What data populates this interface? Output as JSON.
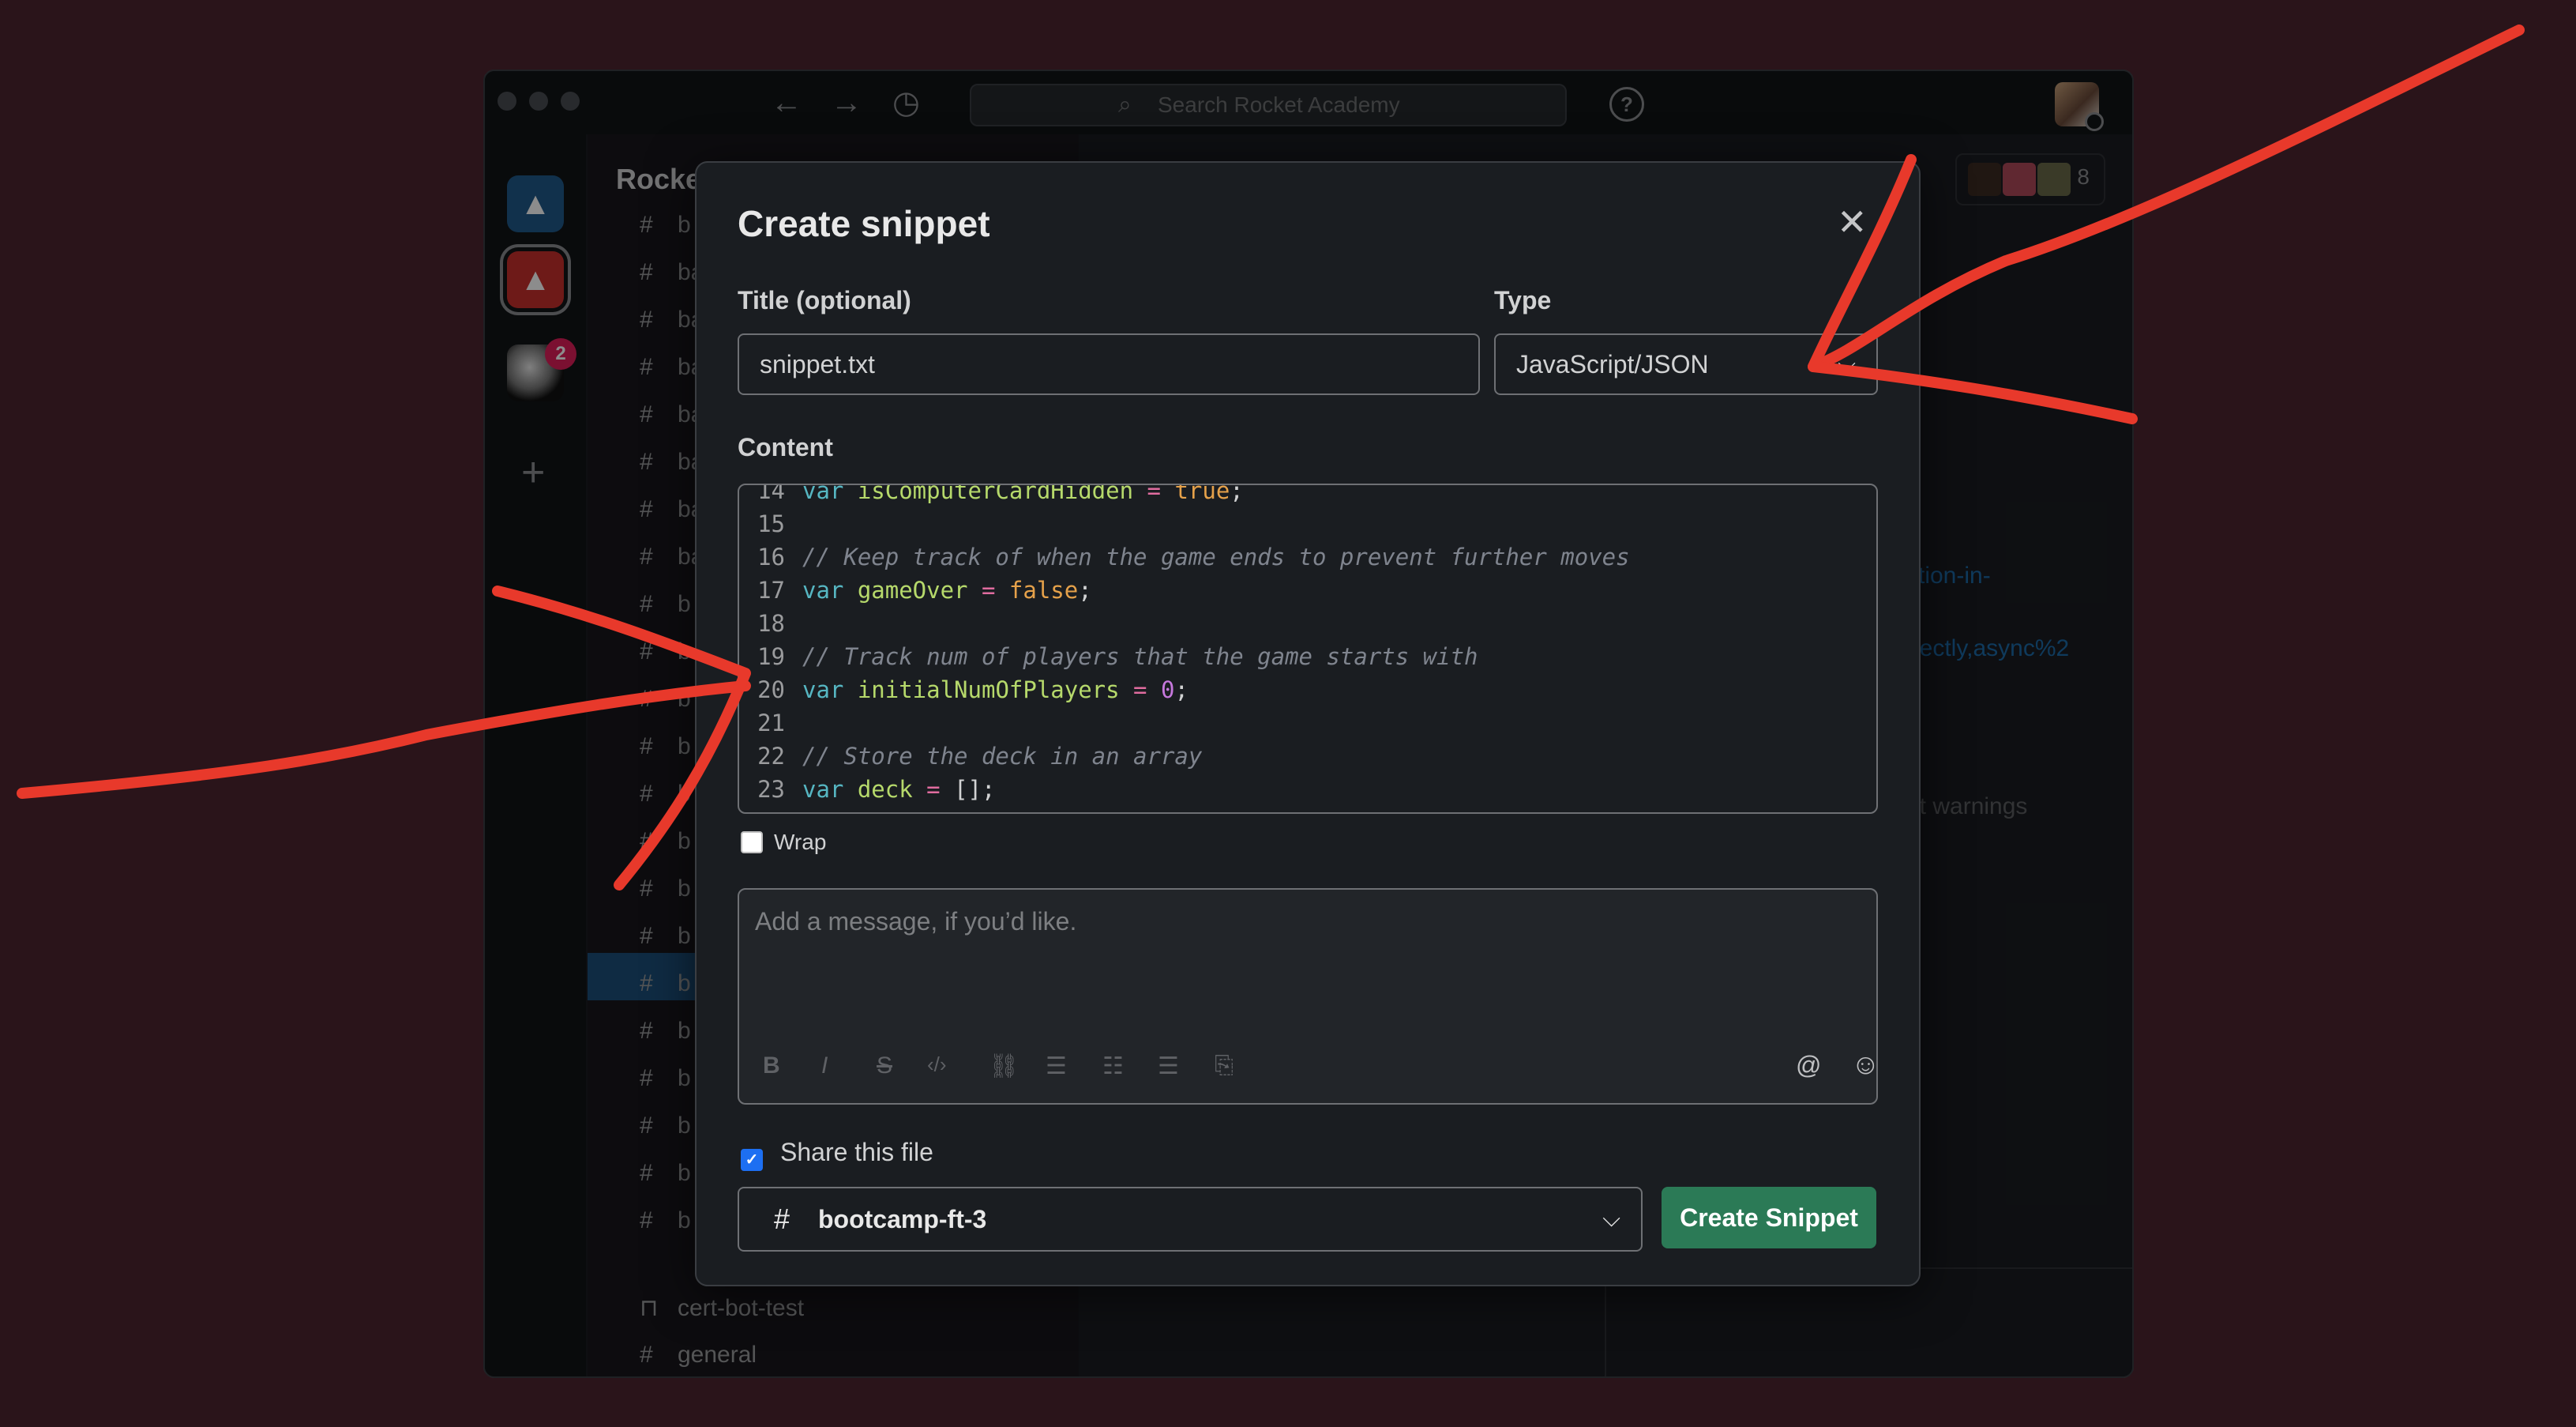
{
  "app": {
    "search_placeholder": "Search Rocket Academy",
    "workspace_name": "Rocke",
    "workspace_badge": "2",
    "member_count": "8",
    "sidebar_channels": [
      "b",
      "ba",
      "ba",
      "ba",
      "ba",
      "ba",
      "ba",
      "ba",
      "b",
      "b",
      "b",
      "b",
      "b",
      "b",
      "b",
      "b",
      "b",
      "b",
      "b",
      "b",
      "b",
      "b"
    ],
    "sidebar_cert": "cert-bot-test",
    "sidebar_general": "general",
    "main_snippets": [
      "ction-in-",
      "irectly,async%2",
      "et warnings"
    ]
  },
  "modal": {
    "title": "Create snippet",
    "title_label": "Title (optional)",
    "title_value": "snippet.txt",
    "type_label": "Type",
    "type_value": "JavaScript/JSON",
    "content_label": "Content",
    "wrap_label": "Wrap",
    "wrap_checked": false,
    "message_placeholder": "Add a message, if you’d like.",
    "share_label": "Share this file",
    "share_checked": true,
    "channel_hash": "#",
    "channel_name": "bootcamp-ft-3",
    "create_button": "Create Snippet"
  },
  "code_lines": [
    {
      "n": "14",
      "tokens": [
        {
          "t": "var ",
          "c": "kw"
        },
        {
          "t": "isComputerCardHidden",
          "c": "id"
        },
        {
          "t": " = ",
          "c": "op"
        },
        {
          "t": "true",
          "c": "lit"
        },
        {
          "t": ";",
          "c": "pn"
        }
      ]
    },
    {
      "n": "15",
      "tokens": []
    },
    {
      "n": "16",
      "tokens": [
        {
          "t": "// Keep track of when the game ends to prevent further moves",
          "c": "cm"
        }
      ]
    },
    {
      "n": "17",
      "tokens": [
        {
          "t": "var ",
          "c": "kw"
        },
        {
          "t": "gameOver",
          "c": "id"
        },
        {
          "t": " = ",
          "c": "op"
        },
        {
          "t": "false",
          "c": "lit"
        },
        {
          "t": ";",
          "c": "pn"
        }
      ]
    },
    {
      "n": "18",
      "tokens": []
    },
    {
      "n": "19",
      "tokens": [
        {
          "t": "// Track num of players that the game starts with",
          "c": "cm"
        }
      ]
    },
    {
      "n": "20",
      "tokens": [
        {
          "t": "var ",
          "c": "kw"
        },
        {
          "t": "initialNumOfPlayers",
          "c": "id"
        },
        {
          "t": " = ",
          "c": "op"
        },
        {
          "t": "0",
          "c": "num"
        },
        {
          "t": ";",
          "c": "pn"
        }
      ]
    },
    {
      "n": "21",
      "tokens": []
    },
    {
      "n": "22",
      "tokens": [
        {
          "t": "// Store the deck in an array",
          "c": "cm"
        }
      ]
    },
    {
      "n": "23",
      "tokens": [
        {
          "t": "var ",
          "c": "kw"
        },
        {
          "t": "deck",
          "c": "id"
        },
        {
          "t": " = ",
          "c": "op"
        },
        {
          "t": "[]",
          "c": "pn"
        },
        {
          "t": ";",
          "c": "pn"
        }
      ]
    }
  ],
  "icons": {
    "close": "✕",
    "chevron_down": "⌵",
    "search": "⌕",
    "back": "←",
    "forward": "→",
    "history": "◷",
    "help": "?",
    "add": "+",
    "mention": "@",
    "emoji": "☺",
    "check": "✓",
    "format_bold": "B",
    "format_italic": "I",
    "format_strike": "S",
    "format_code": "‹/›",
    "format_link": "⛓",
    "format_ordered": "☰",
    "format_bullet": "☷",
    "format_quote": "☰",
    "format_codeblock": "⎘"
  },
  "colors": {
    "background": "#2a141a",
    "annotation": "#e8392b",
    "create_button": "#2b7a56",
    "active_channel": "#1d4f7a"
  }
}
